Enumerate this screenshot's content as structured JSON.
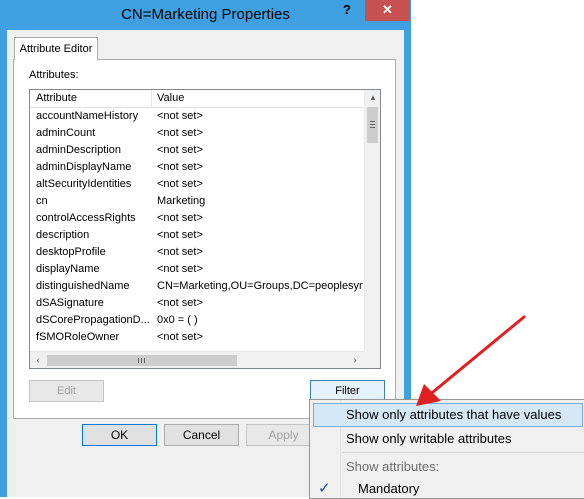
{
  "window": {
    "title": "CN=Marketing Properties",
    "help_label": "?",
    "close_label": "✕"
  },
  "tab": {
    "label": "Attribute Editor"
  },
  "attributes_label": "Attributes:",
  "columns": {
    "attribute": "Attribute",
    "value": "Value"
  },
  "rows": [
    {
      "attribute": "accountNameHistory",
      "value": "<not set>"
    },
    {
      "attribute": "adminCount",
      "value": "<not set>"
    },
    {
      "attribute": "adminDescription",
      "value": "<not set>"
    },
    {
      "attribute": "adminDisplayName",
      "value": "<not set>"
    },
    {
      "attribute": "altSecurityIdentities",
      "value": "<not set>"
    },
    {
      "attribute": "cn",
      "value": "Marketing"
    },
    {
      "attribute": "controlAccessRights",
      "value": "<not set>"
    },
    {
      "attribute": "description",
      "value": "<not set>"
    },
    {
      "attribute": "desktopProfile",
      "value": "<not set>"
    },
    {
      "attribute": "displayName",
      "value": "<not set>"
    },
    {
      "attribute": "distinguishedName",
      "value": "CN=Marketing,OU=Groups,DC=peoplesync,DC="
    },
    {
      "attribute": "dSASignature",
      "value": "<not set>"
    },
    {
      "attribute": "dSCorePropagationD...",
      "value": "0x0 = ( )"
    },
    {
      "attribute": "fSMORoleOwner",
      "value": "<not set>"
    }
  ],
  "buttons": {
    "edit": "Edit",
    "filter": "Filter",
    "ok": "OK",
    "cancel": "Cancel",
    "apply": "Apply"
  },
  "filter_menu": {
    "items": [
      {
        "label": "Show only attributes that have values",
        "highlighted": true
      },
      {
        "label": "Show only writable attributes",
        "highlighted": false
      }
    ],
    "header": "Show attributes:",
    "checked_item": {
      "label": "Mandatory",
      "checked": true
    }
  },
  "colors": {
    "title_bar": "#3fa0e1",
    "close_button": "#c75050",
    "menu_highlight": "#d5e8f8",
    "annotation_arrow": "#e02020"
  },
  "icons": {
    "check": "checkmark-icon",
    "scroll_up": "scroll-up-arrow-icon",
    "scroll_left": "scroll-left-arrow-icon",
    "scroll_right": "scroll-right-arrow-icon"
  }
}
